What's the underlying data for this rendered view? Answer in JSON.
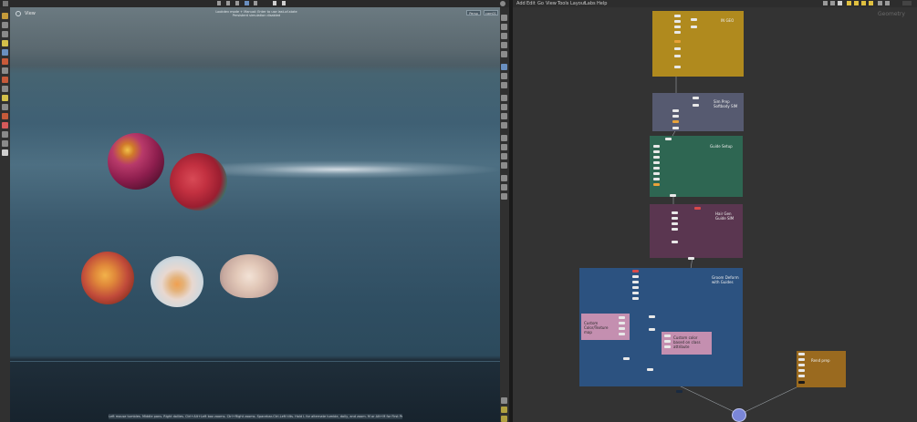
{
  "viewport": {
    "title": "View",
    "hint_line1": "Lookdev mode + Manual: Enter to use last-of-state",
    "hint_line2": "Persistent simulation disabled",
    "persp_label": "Persp",
    "cam_label": "cam01",
    "status_text": "Left mouse tumbles. Middle pans. Right dollies. Ctrl+Alt+Left box zooms. Ctrl+Right zooms. Spacebar-Ctrl-Left tilts. Hold L for alternate tumble, dolly, and zoom. M or Alt+M for First Person Navigation."
  },
  "network": {
    "menu": [
      "Add",
      "Edit",
      "Go",
      "View",
      "Tools",
      "Layout",
      "Labs",
      "Help"
    ],
    "context_label": "Geometry",
    "boxes": [
      {
        "id": "in-geo",
        "label": "IN GEO",
        "color": "#b08a1e"
      },
      {
        "id": "sim-prep",
        "label": "Sim Prep\nSoftbody SIM",
        "color": "#565a70"
      },
      {
        "id": "guide-setup",
        "label": "Guide Setup",
        "color": "#2e6652"
      },
      {
        "id": "hair-gen",
        "label": "Hair Gen\nGuide SIM",
        "color": "#5a3650"
      },
      {
        "id": "groom-deform",
        "label": "Groom Deform\nwith Guides",
        "color": "#2c5280"
      },
      {
        "id": "custom-color",
        "label": "Custom\nColor/Texture\nmap",
        "color": "#c48fb0"
      },
      {
        "id": "custom-color-attr",
        "label": "Custom color\nbased on class\nattribute",
        "color": "#c48fb0"
      },
      {
        "id": "render-prep",
        "label": "Rend prep",
        "color": "#9a6a1f"
      }
    ],
    "output_node_color": "#7a86d8"
  },
  "colors": {
    "accent": "#e8a23a",
    "selected": "#6a8fbf"
  }
}
